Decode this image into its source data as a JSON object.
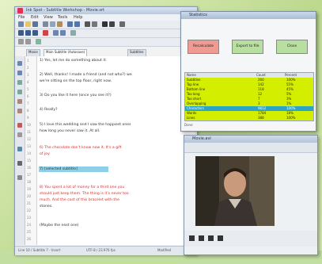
{
  "colors": {
    "background": "#cfe4a8",
    "stats_row": "#d4ee00",
    "stats_row_selected": "#2aa5c8",
    "button_red": "#f19a92",
    "button_green": "#b7df9f"
  },
  "editor": {
    "title": "Ink Spot - Subtitle Workshop - Movie.srt",
    "menu": [
      "File",
      "Edit",
      "View",
      "Tools",
      "Help"
    ],
    "tabs": [
      "Movie",
      "Main Subtitle (Autosave)",
      "Subtitles"
    ],
    "gutter": [
      "1",
      "2",
      "3",
      "4",
      "5",
      "6",
      "7",
      "8",
      "9",
      "10",
      "11",
      "12",
      "13",
      "14",
      "15",
      "16",
      "17",
      "18",
      "19",
      "20",
      "21",
      "22",
      "23",
      "24",
      "25",
      "26"
    ],
    "lines": {
      "l1": "1) Yes, let me do something about it.",
      "l2": "2) Well, thanks! I made a friend (and not who?) we",
      "l3": "we're sitting on the top floor, right now.",
      "l4": "3) Do you like it here (once you see it?)",
      "l5": "4) Really?",
      "l6": "5) I love this wedding and I saw the happiest ones",
      "l7": "how long you never saw it. At all.",
      "l8": "6) The chocolate don't know now it. It's a gift",
      "l9": "of joy.",
      "l10": "7) [selected subtitle]",
      "l11": "8) You spent a lot of money for a third one you",
      "l12": "should just keep them. The thing is it's never too",
      "l13": "much. And the cost of this bracelet with the",
      "l14": "stones.",
      "l15": "(Maybe the next one)"
    },
    "status": {
      "left": "Line 10 / Subtitle 7 - Insert",
      "mid": "UTF-8 / 23.976 fps",
      "right": "Modified"
    }
  },
  "stats": {
    "title": "Statistics",
    "buttons": [
      "Recalculate",
      "Export to file",
      "Close"
    ],
    "table_header": [
      "Name",
      "Count",
      "Percent"
    ],
    "rows": [
      [
        "Subtitles",
        "260",
        "100%"
      ],
      [
        "Top line",
        "142",
        "55%"
      ],
      [
        "Bottom line",
        "118",
        "45%"
      ],
      [
        "Too long",
        "12",
        "5%"
      ],
      [
        "Too short",
        "7",
        "3%"
      ],
      [
        "Overlapping",
        "3",
        "1%"
      ],
      [
        "Characters",
        "9812",
        "100%"
      ],
      [
        "Words",
        "1784",
        "18%"
      ],
      [
        "Lines",
        "388",
        "100%"
      ]
    ],
    "selected_row": 6,
    "footer": "Done"
  },
  "player": {
    "title": "Movie.avi",
    "controls": [
      "play-icon",
      "pause-icon",
      "stop-icon",
      "forward-icon"
    ]
  }
}
